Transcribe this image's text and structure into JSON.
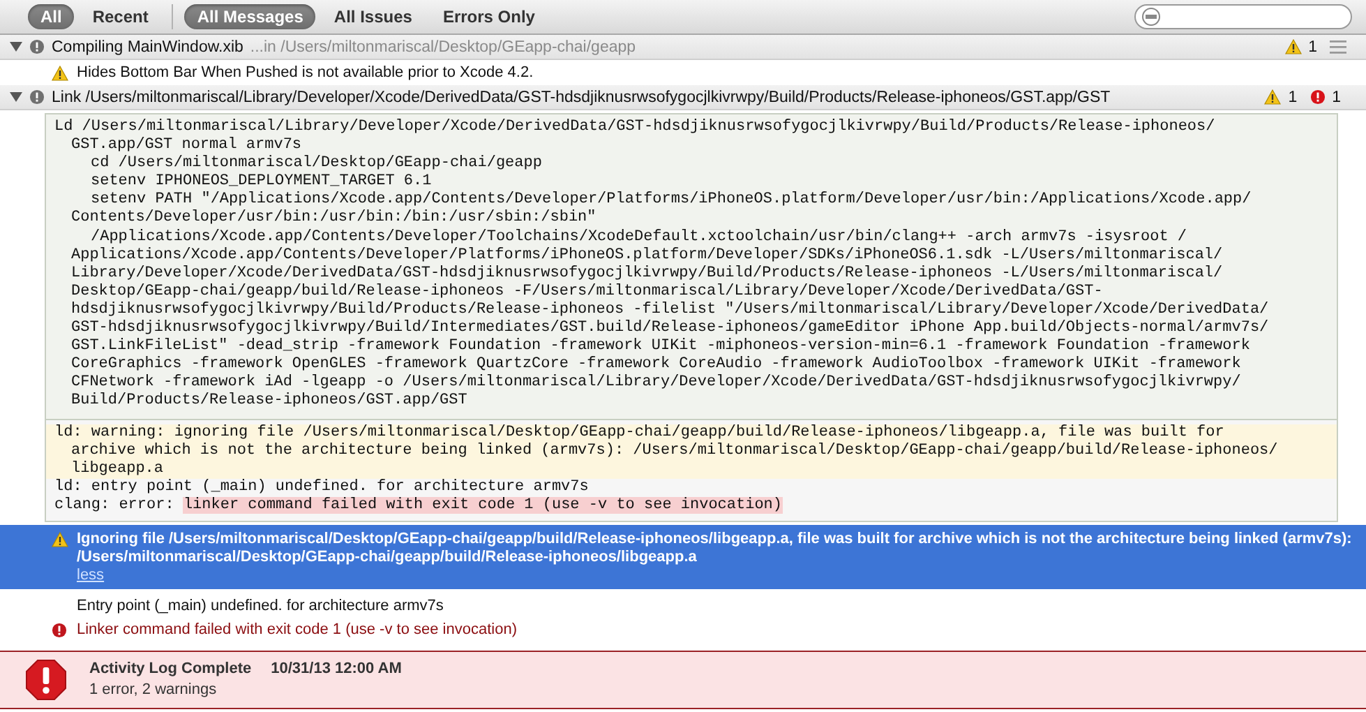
{
  "filter_bar": {
    "scope_tabs": [
      {
        "label": "All",
        "selected": true
      },
      {
        "label": "Recent",
        "selected": false
      }
    ],
    "message_tabs": [
      {
        "label": "All Messages",
        "selected": true
      },
      {
        "label": "All Issues",
        "selected": false
      },
      {
        "label": "Errors Only",
        "selected": false
      }
    ]
  },
  "groups": [
    {
      "title": "Compiling MainWindow.xib",
      "location": "...in /Users/miltonmariscal/Desktop/GEapp-chai/geapp",
      "expanded": true,
      "warnings": "1",
      "messages": [
        {
          "kind": "warning",
          "text": "Hides Bottom Bar When Pushed is not available prior to Xcode 4.2."
        }
      ]
    },
    {
      "title": "Link /Users/miltonmariscal/Library/Developer/Xcode/DerivedData/GST-hdsdjiknusrwsofygocjlkivrwpy/Build/Products/Release-iphoneos/GST.app/GST",
      "expanded": true,
      "warnings": "1",
      "errors": "1",
      "transcript": {
        "command_lines": [
          {
            "kind": "first",
            "text": "Ld /Users/miltonmariscal/Library/Developer/Xcode/DerivedData/GST-hdsdjiknusrwsofygocjlkivrwpy/Build/Products/Release-iphoneos/"
          },
          {
            "kind": "wrap",
            "text": "GST.app/GST normal armv7s"
          },
          {
            "kind": "sub",
            "text": "cd /Users/miltonmariscal/Desktop/GEapp-chai/geapp"
          },
          {
            "kind": "sub",
            "text": "setenv IPHONEOS_DEPLOYMENT_TARGET 6.1"
          },
          {
            "kind": "sub",
            "text": "setenv PATH \"/Applications/Xcode.app/Contents/Developer/Platforms/iPhoneOS.platform/Developer/usr/bin:/Applications/Xcode.app/"
          },
          {
            "kind": "wrap",
            "text": "Contents/Developer/usr/bin:/usr/bin:/bin:/usr/sbin:/sbin\""
          },
          {
            "kind": "sub",
            "text": "/Applications/Xcode.app/Contents/Developer/Toolchains/XcodeDefault.xctoolchain/usr/bin/clang++ -arch armv7s -isysroot /"
          },
          {
            "kind": "wrap",
            "text": "Applications/Xcode.app/Contents/Developer/Platforms/iPhoneOS.platform/Developer/SDKs/iPhoneOS6.1.sdk -L/Users/miltonmariscal/"
          },
          {
            "kind": "wrap",
            "text": "Library/Developer/Xcode/DerivedData/GST-hdsdjiknusrwsofygocjlkivrwpy/Build/Products/Release-iphoneos -L/Users/miltonmariscal/"
          },
          {
            "kind": "wrap",
            "text": "Desktop/GEapp-chai/geapp/build/Release-iphoneos -F/Users/miltonmariscal/Library/Developer/Xcode/DerivedData/GST-"
          },
          {
            "kind": "wrap",
            "text": "hdsdjiknusrwsofygocjlkivrwpy/Build/Products/Release-iphoneos -filelist \"/Users/miltonmariscal/Library/Developer/Xcode/DerivedData/"
          },
          {
            "kind": "wrap",
            "text": "GST-hdsdjiknusrwsofygocjlkivrwpy/Build/Intermediates/GST.build/Release-iphoneos/gameEditor iPhone App.build/Objects-normal/armv7s/"
          },
          {
            "kind": "wrap",
            "text": "GST.LinkFileList\" -dead_strip -framework Foundation -framework UIKit -miphoneos-version-min=6.1 -framework Foundation -framework"
          },
          {
            "kind": "wrap",
            "text": "CoreGraphics -framework OpenGLES -framework QuartzCore -framework CoreAudio -framework AudioToolbox -framework UIKit -framework"
          },
          {
            "kind": "wrap",
            "text": "CFNetwork -framework iAd -lgeapp -o /Users/miltonmariscal/Library/Developer/Xcode/DerivedData/GST-hdsdjiknusrwsofygocjlkivrwpy/"
          },
          {
            "kind": "wrap",
            "text": "Build/Products/Release-iphoneos/GST.app/GST"
          }
        ],
        "warning_lines": [
          {
            "kind": "first",
            "text": "ld: warning: ignoring file /Users/miltonmariscal/Desktop/GEapp-chai/geapp/build/Release-iphoneos/libgeapp.a, file was built for"
          },
          {
            "kind": "wrap",
            "text": "archive which is not the architecture being linked (armv7s): /Users/miltonmariscal/Desktop/GEapp-chai/geapp/build/Release-iphoneos/"
          },
          {
            "kind": "wrap",
            "text": "libgeapp.a"
          }
        ],
        "info_line": "ld: entry point (_main) undefined. for architecture armv7s",
        "error": {
          "prefix": "clang: error:",
          "highlight": "linker command failed with exit code 1 (use -v to see invocation)"
        }
      },
      "issues": [
        {
          "kind": "warning",
          "selected": true,
          "text": "Ignoring file /Users/miltonmariscal/Desktop/GEapp-chai/geapp/build/Release-iphoneos/libgeapp.a, file was built for archive which is not the architecture being linked (armv7s): /Users/miltonmariscal/Desktop/GEapp-chai/geapp/build/Release-iphoneos/libgeapp.a",
          "toggle": "less"
        },
        {
          "kind": "plain",
          "selected": false,
          "text": "Entry point (_main) undefined. for architecture armv7s"
        },
        {
          "kind": "error",
          "selected": false,
          "text": "Linker command failed with exit code 1 (use -v to see invocation)"
        }
      ]
    }
  ],
  "summary": {
    "kind": "error",
    "title": "Activity Log Complete",
    "time": "10/31/13 12:00 AM",
    "detail": "1 error, 2 warnings"
  }
}
